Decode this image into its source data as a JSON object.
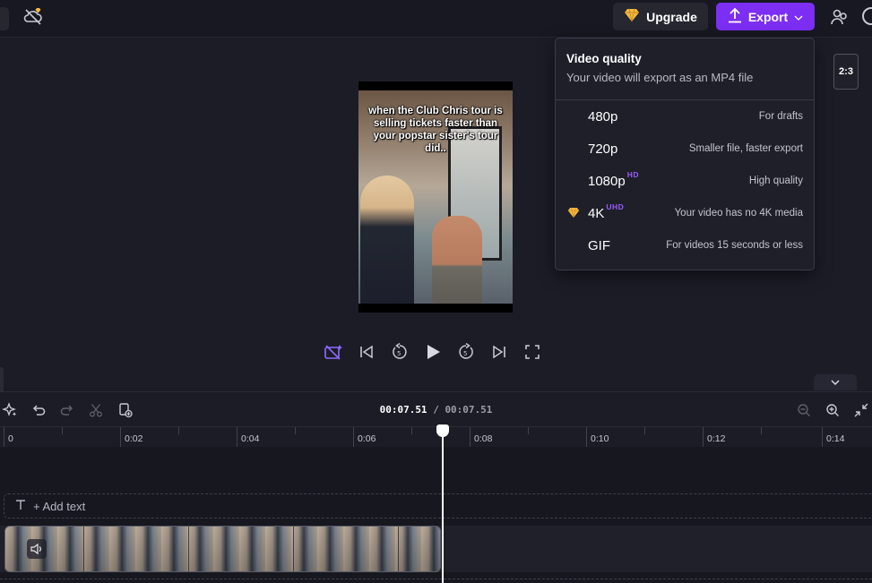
{
  "topbar": {
    "upgrade_label": "Upgrade",
    "export_label": "Export"
  },
  "video": {
    "caption": "when the Club Chris tour is selling tickets faster than your popstar sister's tour did.."
  },
  "preview": {
    "aspect_ratio": "2:3"
  },
  "export_menu": {
    "title": "Video quality",
    "subtitle": "Your video will export as an MP4 file",
    "options": [
      {
        "label": "480p",
        "badge": "",
        "desc": "For drafts",
        "premium": false
      },
      {
        "label": "720p",
        "badge": "",
        "desc": "Smaller file, faster export",
        "premium": false
      },
      {
        "label": "1080p",
        "badge": "HD",
        "desc": "High quality",
        "premium": false
      },
      {
        "label": "4K",
        "badge": "UHD",
        "desc": "Your video has no 4K media",
        "premium": true
      },
      {
        "label": "GIF",
        "badge": "",
        "desc": "For videos 15 seconds or less",
        "premium": false
      }
    ]
  },
  "timeline": {
    "current_time": "00:07.51",
    "separator": "/",
    "total_time": "00:07.51",
    "ruler_labels": [
      "0",
      "0:02",
      "0:04",
      "0:06",
      "0:08",
      "0:10",
      "0:12",
      "0:14"
    ],
    "add_text_label": "+ Add text"
  },
  "colors": {
    "accent": "#7c2ef2",
    "badge": "#9b5cff",
    "premium_gem": "#f5b942",
    "background": "#1a1b26"
  },
  "icons": {
    "gem": "gem-icon",
    "export": "upload-arrow-icon",
    "share": "people-icon",
    "cloud": "cloud-off-icon"
  }
}
